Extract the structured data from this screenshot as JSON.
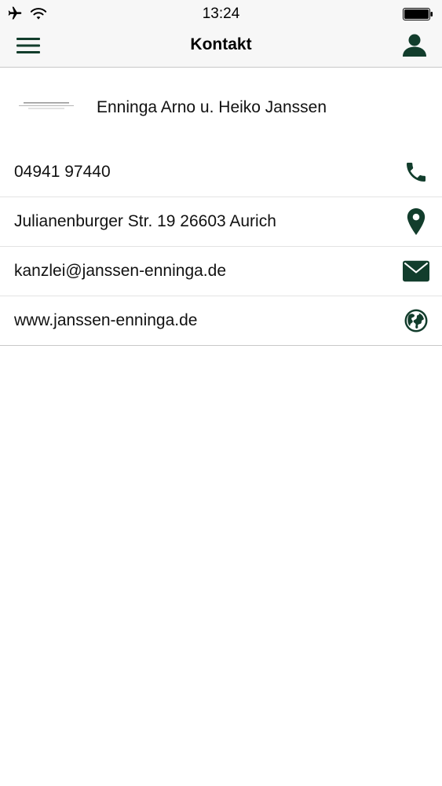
{
  "status_bar": {
    "time": "13:24",
    "icons": [
      "airplane-icon",
      "wifi-icon",
      "battery-icon"
    ]
  },
  "nav": {
    "title": "Kontakt",
    "left_icon": "menu-icon",
    "right_icon": "profile-icon"
  },
  "company": {
    "name": "Enninga Arno u. Heiko Janssen",
    "logo_text": "JANSSEN & ENNINGA"
  },
  "contacts": [
    {
      "value": "04941 97440",
      "icon": "phone-icon"
    },
    {
      "value": "Julianenburger Str. 19 26603 Aurich",
      "icon": "location-pin-icon"
    },
    {
      "value": "kanzlei@janssen-enninga.de",
      "icon": "mail-icon"
    },
    {
      "value": "www.janssen-enninga.de",
      "icon": "globe-icon"
    }
  ],
  "colors": {
    "accent": "#123d2c",
    "bar_background": "#f7f7f7",
    "divider": "#e3e3e3"
  }
}
